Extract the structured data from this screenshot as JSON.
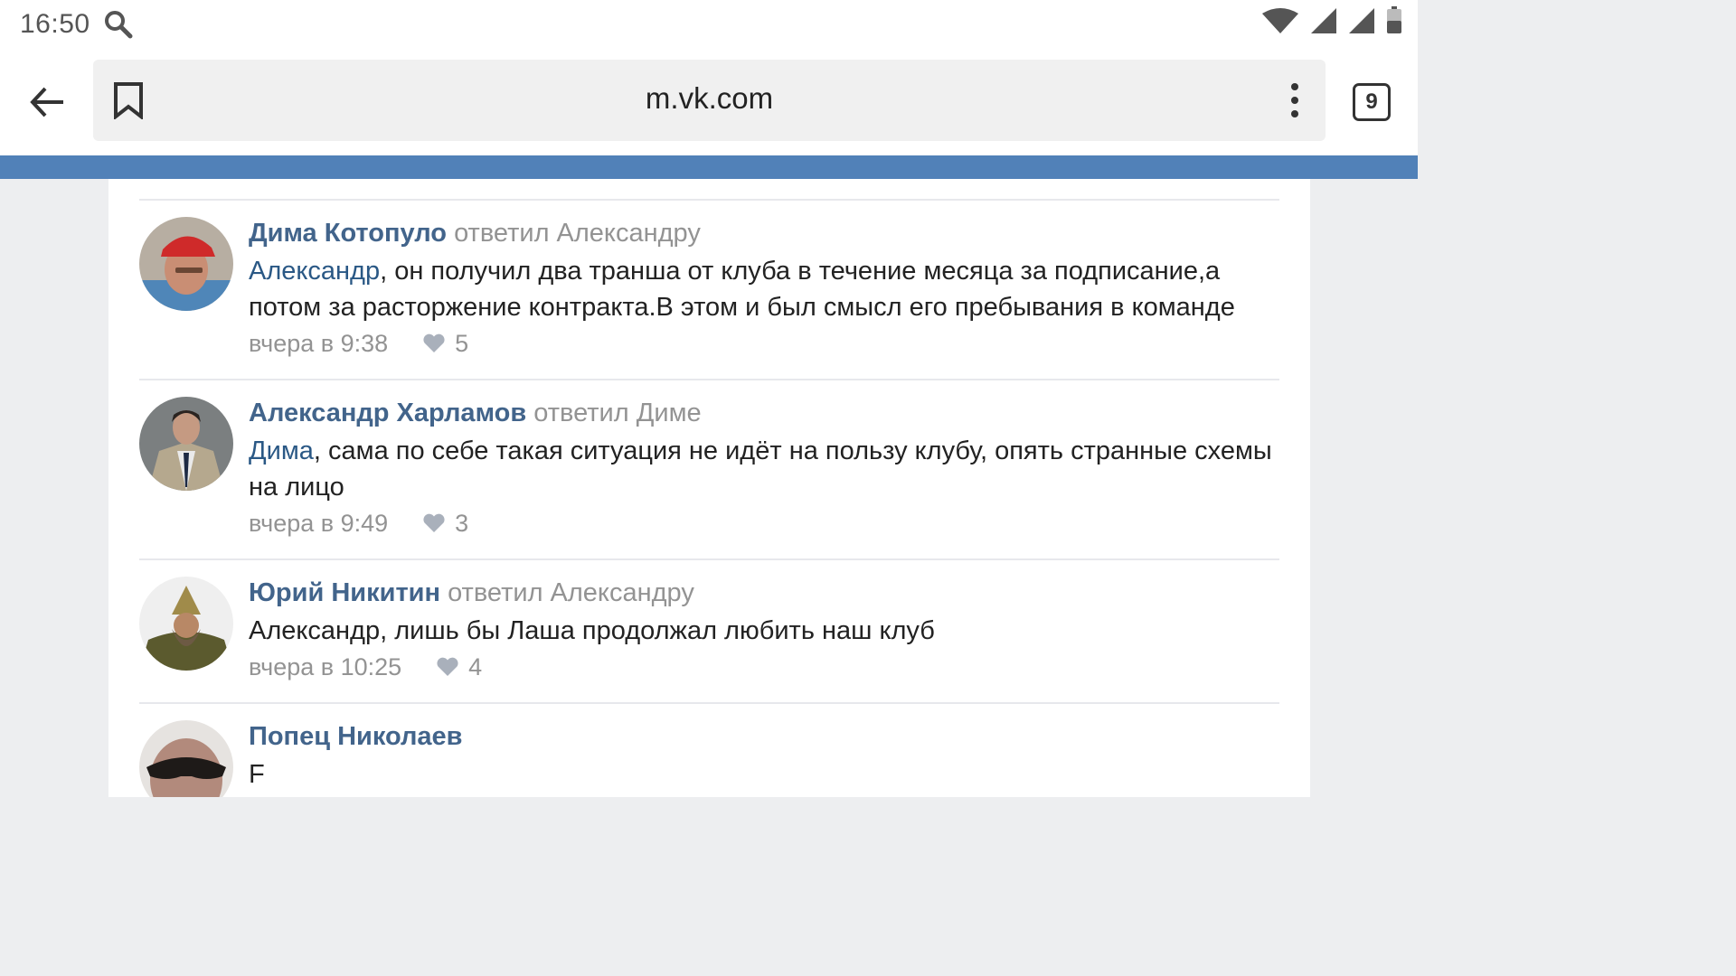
{
  "status_bar": {
    "time": "16:50"
  },
  "browser": {
    "url": "m.vk.com",
    "tab_count": "9"
  },
  "comments": [
    {
      "author": "Дима Котопуло",
      "reply_note": "ответил Александру",
      "mention": "Александр",
      "text": ", он получил два транша от клуба в течение месяца за подписание,а потом за расторжение контракта.В этом и был смысл его пребывания в команде",
      "time": "вчера в 9:38",
      "likes": "5"
    },
    {
      "author": "Александр Харламов",
      "reply_note": "ответил Диме",
      "mention": "Дима",
      "text": ", сама по себе такая ситуация не идёт на пользу клубу, опять странные схемы на лицо",
      "time": "вчера в 9:49",
      "likes": "3"
    },
    {
      "author": "Юрий Никитин",
      "reply_note": "ответил Александру",
      "text": "Александр, лишь бы Лаша продолжал любить наш клуб",
      "time": "вчера в 10:25",
      "likes": "4"
    },
    {
      "author": "Попец Николаев",
      "text": "F"
    }
  ]
}
